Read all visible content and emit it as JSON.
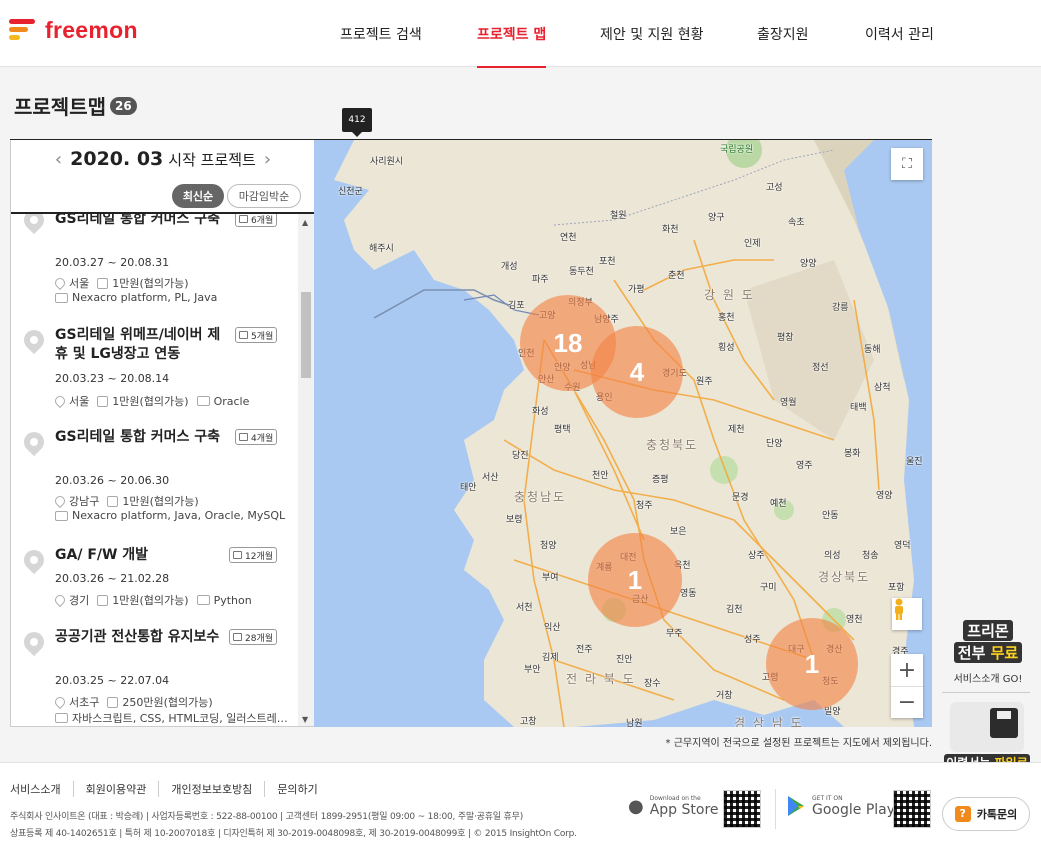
{
  "header": {
    "logo": "freemon",
    "nav": [
      {
        "label": "프로젝트 검색",
        "active": false
      },
      {
        "label": "프로젝트 맵",
        "active": true
      },
      {
        "label": "제안 및 지원 현황",
        "active": false
      },
      {
        "label": "출장지원",
        "active": false
      },
      {
        "label": "이력서 관리",
        "active": false
      }
    ]
  },
  "page": {
    "title": "프로젝트맵",
    "count": "26",
    "tooltip": "412"
  },
  "panel": {
    "month": "2020. 03",
    "month_sub": "시작 프로젝트",
    "prev": "‹",
    "next": "›",
    "sort_latest": "최신순",
    "sort_deadline": "마감임박순",
    "items": [
      {
        "title": "GS리테일 통합 커머스 구축",
        "duration": "6개월",
        "dates": "20.03.27 ~ 20.08.31",
        "location": "서울",
        "pay": "1만원(협의가능)",
        "skills": "Nexacro platform, PL, Java"
      },
      {
        "title": "GS리테일 위메프/네이버 제휴 및 LG냉장고 연동",
        "duration": "5개월",
        "dates": "20.03.23 ~ 20.08.14",
        "location": "서울",
        "pay": "1만원(협의가능)",
        "skills": "Oracle"
      },
      {
        "title": "GS리테일 통합 커머스 구축",
        "duration": "4개월",
        "dates": "20.03.26 ~ 20.06.30",
        "location": "강남구",
        "pay": "1만원(협의가능)",
        "skills": "Nexacro platform, Java, Oracle, MySQL"
      },
      {
        "title": "GA/ F/W 개발",
        "duration": "12개월",
        "dates": "20.03.26 ~ 21.02.28",
        "location": "경기",
        "pay": "1만원(협의가능)",
        "skills": "Python"
      },
      {
        "title": "공공기관 전산통합 유지보수",
        "duration": "28개월",
        "dates": "20.03.25 ~ 22.07.04",
        "location": "서초구",
        "pay": "250만원(협의가능)",
        "skills": "자바스크립트, CSS, HTML코딩, 일러스트레…"
      }
    ]
  },
  "map": {
    "clusters": [
      {
        "label": "18"
      },
      {
        "label": "4"
      },
      {
        "label": "1"
      },
      {
        "label": "1"
      }
    ],
    "places": {
      "gyeonggi": "경기도",
      "gangwon": "강 원 도",
      "chungbuk": "충청북도",
      "chungnam": "충청남도",
      "gyeongbuk": "경상북도",
      "jeonbuk": "전 라 북 도",
      "gyeongnam": "경 상 남 도",
      "park": "국립공원",
      "sariwon": "사리원시",
      "haeju": "해주시",
      "sinchon": "신천군",
      "kaesong": "개성",
      "yeoncheon": "연천",
      "pocheon": "포천",
      "cheorwon": "철원",
      "paju": "파주",
      "dongducheon": "동두천",
      "gapyeong": "가평",
      "chuncheon": "춘천",
      "hwacheon": "화천",
      "inje": "인제",
      "yanggu": "양구",
      "sokcho": "속초",
      "goseong": "고성",
      "yangyang": "양양",
      "gangneung": "강릉",
      "hongcheon": "홍천",
      "pyeongchang": "평창",
      "jeongseon": "정선",
      "donghae": "동해",
      "samcheok": "삼척",
      "taebaek": "태백",
      "yeongwol": "영월",
      "wonju": "원주",
      "hoengseong": "횡성",
      "gimpo": "김포",
      "goyang": "고양",
      "uijeongbu": "의정부",
      "namyangju": "남양주",
      "incheon": "인천",
      "seongnam": "성남",
      "anyang": "안양",
      "ansan": "안산",
      "suwon": "수원",
      "yongin": "용인",
      "hwaseong": "화성",
      "pyeongtaek": "평택",
      "jecheon": "제천",
      "danyang": "단양",
      "yeongju": "영주",
      "bonghwa": "봉화",
      "uljin": "울진",
      "yeongyang": "영양",
      "andong": "안동",
      "yecheon": "예천",
      "mungyeong": "문경",
      "cheongju": "청주",
      "cheonan": "천안",
      "dangjin": "당진",
      "seosan": "서산",
      "taean": "태안",
      "jeungpyeong": "증평",
      "boeun": "보은",
      "okcheon": "옥천",
      "yeongdong": "영동",
      "daejeon": "대전",
      "gyeryong": "계룡",
      "geumsan": "금산",
      "buyeo": "부여",
      "cheongyang": "청양",
      "boryeong": "보령",
      "seocheon": "서천",
      "gimcheon": "김천",
      "gumi": "구미",
      "sangju": "상주",
      "uiseong": "의성",
      "cheongsong": "청송",
      "yeongdeok": "영덕",
      "pohang": "포항",
      "yeongcheon": "영천",
      "gyeongju": "경주",
      "daegu": "대구",
      "gyeongsan": "경산",
      "cheongdo": "청도",
      "miryang": "밀양",
      "goryeong": "고령",
      "seongju": "성주",
      "muju": "무주",
      "jinan": "진안",
      "jangsu": "장수",
      "jeonju": "전주",
      "gimje": "김제",
      "buan": "부안",
      "iksan": "익산",
      "gochang": "고창",
      "namwon": "남원",
      "geochang": "거창"
    },
    "note": "* 근무지역이 전국으로 설정된 프로젝트는 지도에서 제외됩니다."
  },
  "side": {
    "promo_line1": "프리몬",
    "promo_line2a": "전부 ",
    "promo_line2b": "무료",
    "promo_text": "서비스소개 GO!",
    "resume_a": "이력서는 ",
    "resume_b": "파일로"
  },
  "footer": {
    "links": [
      "서비스소개",
      "회원이용약관",
      "개인정보보호방침",
      "문의하기"
    ],
    "info1": "주식회사 인사이트온 (대표 : 박승례)  |  사업자등록번호 : 522-88-00100  |  고객센터 1899-2951(평일 09:00 ~ 18:00, 주말·공휴일 휴무)",
    "info2": "상표등록 제 40-1402651호  |  특허 제 10-2007018호  |  디자인특허 제 30-2019-0048098호, 제 30-2019-0048099호  |  © 2015 InsightOn Corp.",
    "appstore_small": "Download on the",
    "appstore": "App Store",
    "googleplay_small": "GET IT ON",
    "googleplay": "Google Play",
    "kakao": "카톡문의",
    "kakao_icon": "?"
  }
}
